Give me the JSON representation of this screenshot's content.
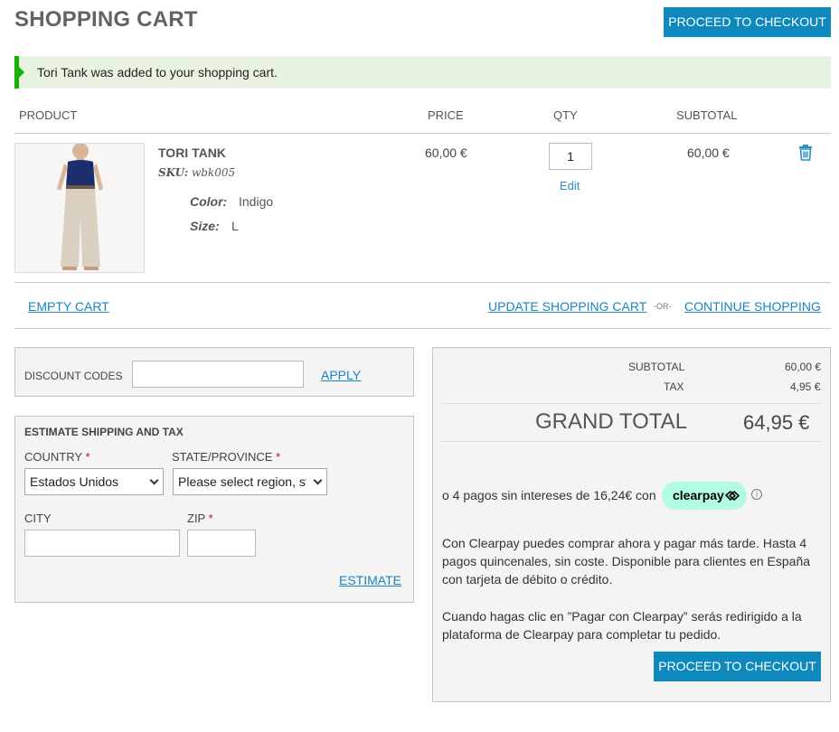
{
  "page": {
    "title": "SHOPPING CART",
    "checkout_label": "PROCEED TO CHECKOUT",
    "success_message": "Tori Tank was added to your shopping cart."
  },
  "table": {
    "headers": [
      "PRODUCT",
      "PRICE",
      "QTY",
      "SUBTOTAL"
    ]
  },
  "item": {
    "name": "TORI TANK",
    "sku_label": "SKU:",
    "sku": "wbk005",
    "options": [
      {
        "label": "Color:",
        "value": "Indigo"
      },
      {
        "label": "Size:",
        "value": "L"
      }
    ],
    "price": "60,00 €",
    "qty": "1",
    "edit_label": "Edit",
    "subtotal": "60,00 €",
    "remove_icon": "trash-icon"
  },
  "actions": {
    "empty_cart": "EMPTY CART",
    "update_cart": "UPDATE SHOPPING CART",
    "or": "-OR-",
    "continue_shopping": "CONTINUE SHOPPING"
  },
  "discount": {
    "label": "DISCOUNT CODES",
    "value": "",
    "apply": "APPLY"
  },
  "shipping": {
    "title": "ESTIMATE SHIPPING AND TAX",
    "country_label": "COUNTRY",
    "country_value": "Estados Unidos",
    "state_label": "STATE/PROVINCE",
    "state_value": "Please select region, state or province",
    "city_label": "CITY",
    "zip_label": "ZIP",
    "required_mark": "*",
    "estimate": "ESTIMATE"
  },
  "totals": {
    "subtotal_label": "SUBTOTAL",
    "subtotal_value": "60,00 €",
    "tax_label": "TAX",
    "tax_value": "4,95 €",
    "grand_label": "GRAND TOTAL",
    "grand_value": "64,95 €"
  },
  "clearpay": {
    "installments": "o 4 pagos sin intereses de 16,24€ con",
    "badge": "clearpay",
    "info_icon": "info-icon",
    "info_glyph": "i",
    "p1_line1": "Con Clearpay puedes comprar ahora y pagar más tarde. Hasta 4",
    "p1_line2": "pagos quincenales, sin coste. Disponible para clientes en España",
    "p1_line3": "con tarjeta de débito o crédito.",
    "p2_line1": "Cuando hagas clic en ”Pagar con Clearpay” serás redirigido a la",
    "p2_line2": "plataforma de Clearpay para completar tu pedido."
  },
  "colors": {
    "accent": "#0e89bd",
    "success_bg": "#e9f3e2",
    "success_bar": "#11b400",
    "clearpay_mint": "#b2fce4"
  }
}
